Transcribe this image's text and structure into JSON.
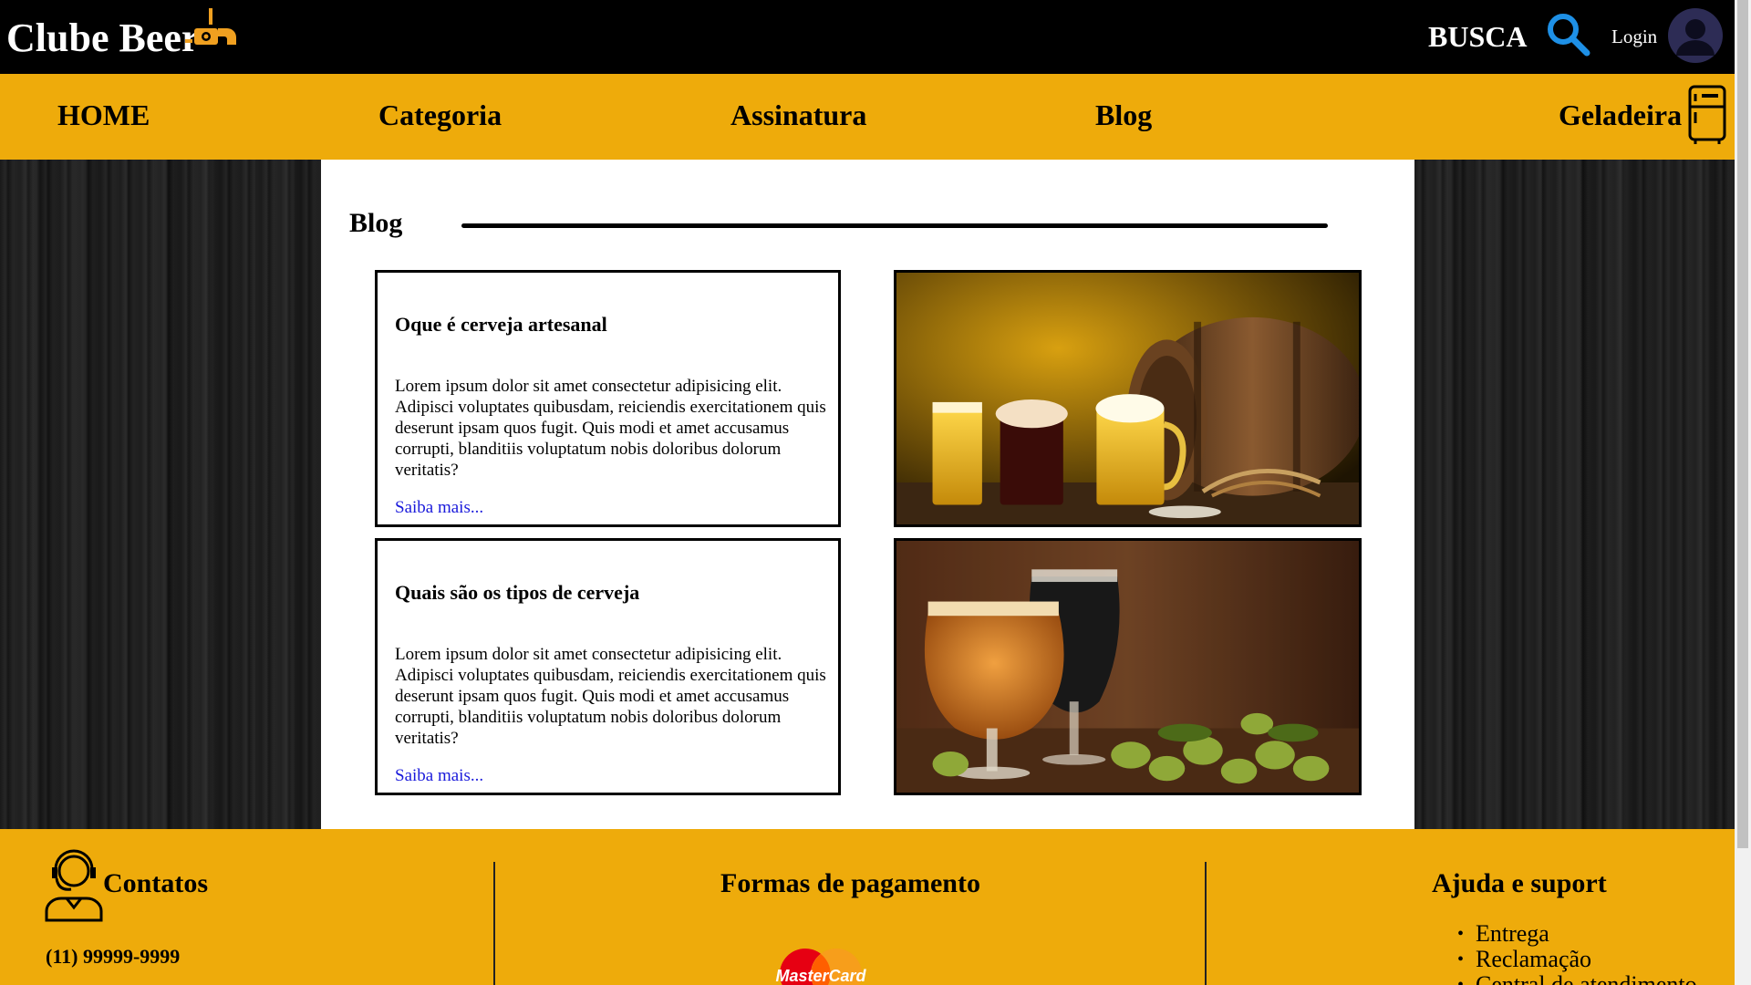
{
  "header": {
    "brand": "Clube Beer",
    "search_label": "BUSCA",
    "login_label": "Login",
    "icons": [
      "beer-tap-icon",
      "search-icon",
      "user-avatar-icon"
    ]
  },
  "nav": {
    "items": [
      "HOME",
      "Categoria",
      "Assinatura",
      "Blog",
      "Geladeira"
    ],
    "cart_icon": "fridge-icon"
  },
  "blog": {
    "title": "Blog",
    "posts": [
      {
        "title": "Oque é cerveja artesanal",
        "text": "Lorem ipsum dolor sit amet consectetur adipisicing elit. Adipisci voluptates quibusdam, reiciendis exercitationem quis deserunt ipsam quos fugit. Quis modi et amet accusamus corrupti, blanditiis voluptatum nobis doloribus dolorum veritatis?",
        "link": "Saiba mais..."
      },
      {
        "title": "Quais são os tipos de cerveja",
        "text": "Lorem ipsum dolor sit amet consectetur adipisicing elit. Adipisci voluptates quibusdam, reiciendis exercitationem quis deserunt ipsam quos fugit. Quis modi et amet accusamus corrupti, blanditiis voluptatum nobis doloribus dolorum veritatis?",
        "link": "Saiba mais..."
      }
    ]
  },
  "footer": {
    "contacts": {
      "title": "Contatos",
      "phone": "(11) 99999-9999"
    },
    "payment": {
      "title": "Formas de pagamento",
      "card_brand": "MasterCard"
    },
    "help": {
      "title": "Ajuda e suport",
      "items": [
        "Entrega",
        "Reclamação",
        "Central de atendimento"
      ]
    }
  },
  "colors": {
    "accent": "#eeab0b",
    "topbar": "#000000",
    "link": "#1a1adb"
  }
}
